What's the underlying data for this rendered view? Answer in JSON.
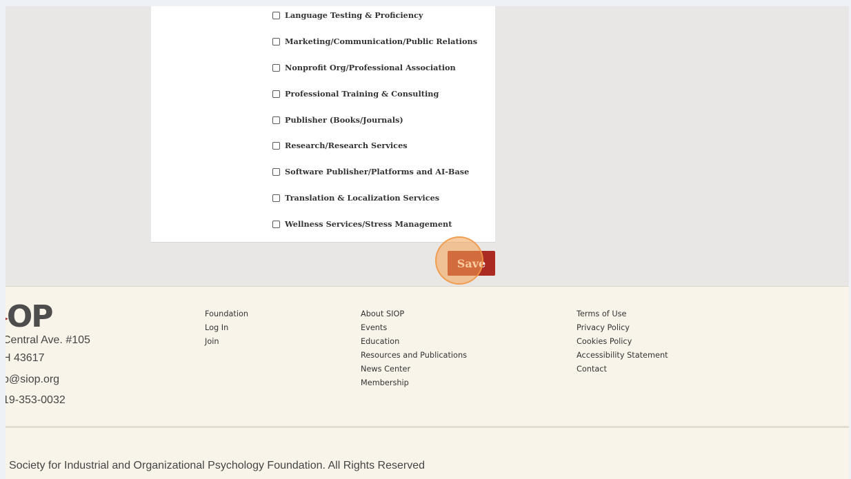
{
  "checkbox_options": [
    {
      "label": "Language Testing & Proficiency",
      "checked": false
    },
    {
      "label": "Marketing/Communication/Public Relations",
      "checked": false
    },
    {
      "label": "Nonprofit Org/Professional Association",
      "checked": false
    },
    {
      "label": "Professional Training & Consulting",
      "checked": false
    },
    {
      "label": "Publisher (Books/Journals)",
      "checked": false
    },
    {
      "label": "Research/Research Services",
      "checked": false
    },
    {
      "label": "Software Publisher/Platforms and AI-Base",
      "checked": false
    },
    {
      "label": "Translation & Localization Services",
      "checked": false
    },
    {
      "label": "Wellness Services/Stress Management",
      "checked": false
    }
  ],
  "save_label": "Save",
  "footer": {
    "logo_text": "OP",
    "address_line1": "Central Ave. #105",
    "address_line2": "H 43617",
    "email": "p@siop.org",
    "phone": "19-353-0032",
    "col1": [
      "Foundation",
      "Log In",
      "Join"
    ],
    "col2": [
      "About SIOP",
      "Events",
      "Education",
      "Resources and Publications",
      "News Center",
      "Membership"
    ],
    "col3": [
      "Terms of Use",
      "Privacy Policy",
      "Cookies Policy",
      "Accessibility Statement",
      "Contact"
    ],
    "copyright": "Society for Industrial and Organizational Psychology Foundation. All Rights Reserved"
  },
  "colors": {
    "accent": "#ab2a22",
    "footer_bg": "#f8f4e9",
    "page_bg": "#e8e7e6"
  }
}
